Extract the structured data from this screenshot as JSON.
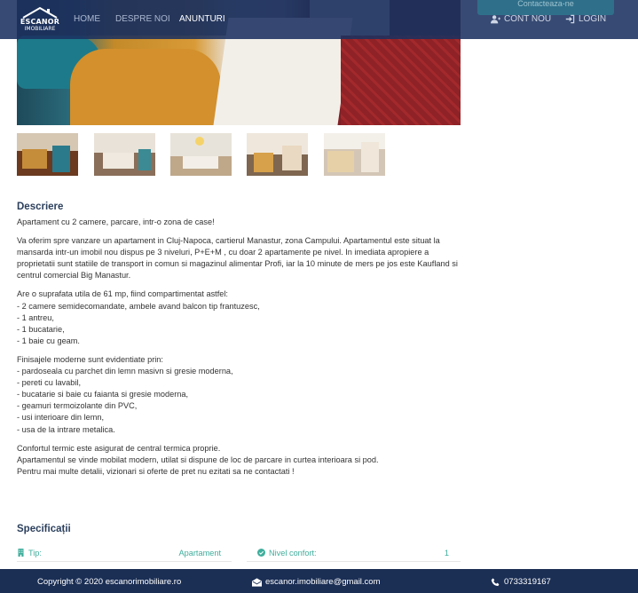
{
  "navbar": {
    "logo_line1": "ESCANOR",
    "logo_line2": "IMOBILIARE",
    "links": [
      "HOME",
      "DESPRE NOI",
      "ANUNTURI"
    ],
    "active_link": "ANUNTURI",
    "account": {
      "register_label": "CONT NOU",
      "login_label": "LOGIN"
    },
    "contact_button_label": "Contacteaza-ne"
  },
  "gallery": {
    "thumbnails": [
      "photo-1",
      "photo-2",
      "photo-3",
      "photo-4",
      "photo-5"
    ]
  },
  "description": {
    "title": "Descriere",
    "paragraphs": [
      "Apartament cu 2 camere, parcare, intr-o zona de case!",
      "Va oferim spre vanzare un apartament in Cluj-Napoca, cartierul Manastur, zona Campului. Apartamentul este situat la mansarda intr-un imobil nou dispus pe 3 niveluri, P+E+M , cu doar 2 apartamente pe nivel. In imediata apropiere a proprietatii sunt statiile de transport in comun si magazinul alimentar Profi, iar la 10 minute de mers pe jos este Kaufland si centrul comercial Big Manastur.",
      "Are o suprafata utila de 61 mp, fiind compartimentat astfel:\n- 2 camere semidecomandate, ambele avand balcon tip frantuzesc,\n- 1 antreu,\n- 1 bucatarie,\n- 1 baie cu geam.",
      "Finisajele moderne sunt evidentiate prin:\n- pardoseala cu parchet din lemn masivn si gresie moderna,\n- pereti cu lavabil,\n- bucatarie si baie cu faianta si gresie moderna,\n- geamuri termoizolante din PVC,\n- usi interioare din lemn,\n- usa de la intrare metalica.",
      "Confortul termic este asigurat de central termica proprie.\nApartamentul se vinde mobilat modern, utilat si dispune de loc de parcare in curtea interioara si pod.\nPentru mai multe detalii, vizionari si oferte de pret nu ezitati sa ne contactati !"
    ]
  },
  "specs": {
    "title": "Specificații",
    "rows": [
      {
        "label": "Tip:",
        "value": "Apartament"
      },
      {
        "label": "Nivel confort:",
        "value": "1"
      }
    ]
  },
  "footer": {
    "copyright": "Copyright © 2020 escanorimobiliare.ro",
    "email": "escanor.imobiliare@gmail.com",
    "phone": "0733319167"
  },
  "colors": {
    "navbar": "#1b3160",
    "footer": "#1b2f55",
    "accent": "#3fae9c",
    "heading": "#2b3f5c"
  }
}
